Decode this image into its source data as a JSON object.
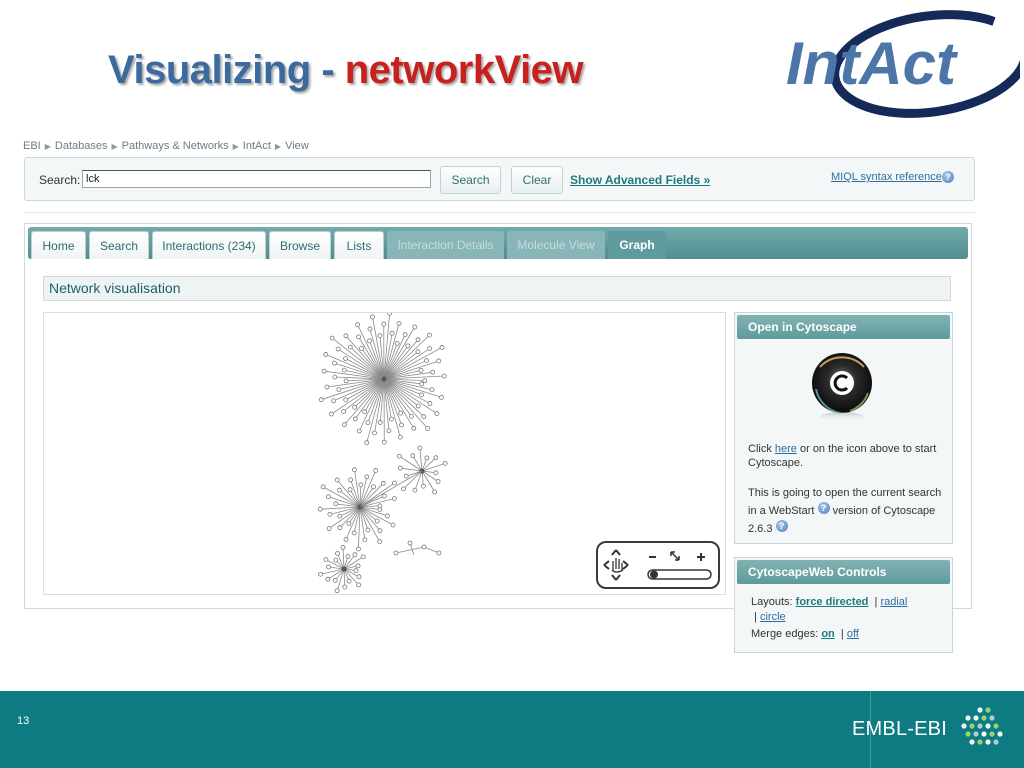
{
  "slide": {
    "title_part1": "Visualizing - ",
    "title_part2": "networkView",
    "number": "13",
    "title_color_1": "#3a6a9e",
    "title_color_2": "#c8201c"
  },
  "logo": {
    "text": "IntAct",
    "color": "#4d76a8"
  },
  "breadcrumb": [
    "EBI",
    "Databases",
    "Pathways & Networks",
    "IntAct",
    "View"
  ],
  "search": {
    "label": "Search:",
    "value": "lck",
    "search_button": "Search",
    "clear_button": "Clear",
    "advanced_link": "Show Advanced Fields »",
    "miql_link": "MIQL syntax reference",
    "help_icon": "help-icon"
  },
  "tabs": [
    {
      "label": "Home",
      "state": "enabled"
    },
    {
      "label": "Search",
      "state": "enabled"
    },
    {
      "label": "Interactions (234)",
      "state": "enabled"
    },
    {
      "label": "Browse",
      "state": "enabled"
    },
    {
      "label": "Lists",
      "state": "enabled"
    },
    {
      "label": "Interaction Details",
      "state": "disabled"
    },
    {
      "label": "Molecule View",
      "state": "disabled"
    },
    {
      "label": "Graph",
      "state": "active"
    }
  ],
  "section": {
    "heading": "Network visualisation"
  },
  "cytoscape": {
    "title": "Open in Cytoscape",
    "icon": "cytoscape-icon",
    "click_prefix": "Click ",
    "click_link": "here",
    "click_suffix": " or on the icon above to start Cytoscape.",
    "info_text": "This is going to open the current search in a WebStart",
    "version_text": "version of Cytoscape 2.6.3"
  },
  "controls": {
    "title": "CytoscapeWeb Controls",
    "layouts_label": "Layouts:",
    "layout_force": "force directed",
    "layout_radial": "radial",
    "layout_circle": "circle",
    "separator": "|",
    "merge_label": "Merge edges:",
    "merge_on": "on",
    "merge_off": "off"
  },
  "footer": {
    "org": "EMBL-EBI",
    "color": "#0e7a82"
  },
  "colors": {
    "accent": "#5d9b9d",
    "link": "#2a6fa0",
    "link_bold": "#1f7a7e"
  }
}
